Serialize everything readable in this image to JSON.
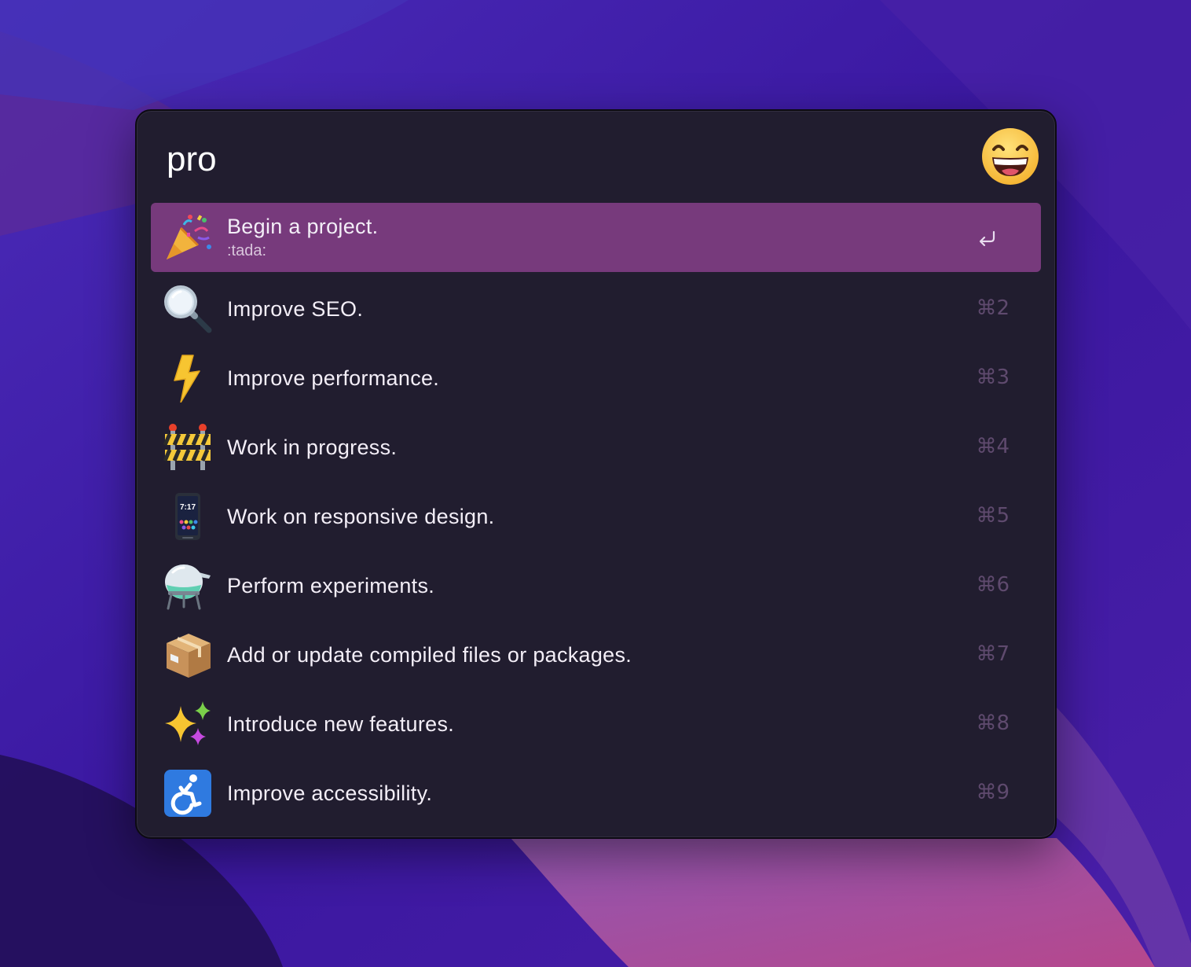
{
  "search": {
    "query": "pro"
  },
  "mood_icon": "grinning-face-icon",
  "results": [
    {
      "title": "Begin a project.",
      "code": ":tada:",
      "icon": "party-popper-icon",
      "shortcut": "",
      "selected": true
    },
    {
      "title": "Improve SEO.",
      "icon": "magnifying-glass-icon",
      "shortcut": "⌘2"
    },
    {
      "title": "Improve performance.",
      "icon": "lightning-bolt-icon",
      "shortcut": "⌘3"
    },
    {
      "title": "Work in progress.",
      "icon": "construction-barrier-icon",
      "shortcut": "⌘4"
    },
    {
      "title": "Work on responsive design.",
      "icon": "mobile-phone-icon",
      "shortcut": "⌘5",
      "phone_time": "7:17"
    },
    {
      "title": "Perform experiments.",
      "icon": "alembic-icon",
      "shortcut": "⌘6"
    },
    {
      "title": "Add or update compiled files or packages.",
      "icon": "package-icon",
      "shortcut": "⌘7"
    },
    {
      "title": "Introduce new features.",
      "icon": "sparkles-icon",
      "shortcut": "⌘8"
    },
    {
      "title": "Improve accessibility.",
      "icon": "wheelchair-icon",
      "shortcut": "⌘9"
    }
  ],
  "colors": {
    "window_bg": "#211d2f",
    "selected_row": "#773a7c",
    "shortcut_text": "#5f4a6e"
  }
}
